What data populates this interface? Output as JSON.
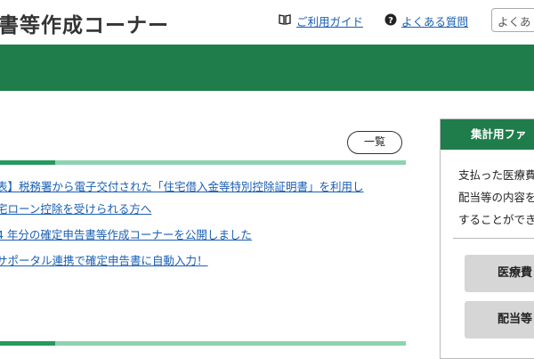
{
  "header": {
    "site_title": "書等作成コーナー",
    "guide_link": "ご利用ガイド",
    "faq_link": "よくある質問",
    "search_text": "よくあ",
    "guide_icon": "book-icon",
    "faq_icon": "question-circle-icon"
  },
  "news": {
    "list_button": "一覧",
    "items": [
      "表】税務署から電子交付された「住宅借入金等特別控除証明書」を利用し",
      "宅ローン控除を受けられる方へ",
      "4 年分の確定申告書等作成コーナーを公開しました",
      "サポータル連携で確定申告書に自動入力！"
    ]
  },
  "side": {
    "title": "集計用ファ",
    "lines": [
      "支払った医療費",
      "配当等の内容を",
      "することができ"
    ],
    "buttons": [
      "医療費",
      "配当等"
    ]
  },
  "colors": {
    "brand_green": "#1e7d4a",
    "rule_light": "#8ed3b1",
    "rule_dark": "#26995d",
    "link_blue": "#1a5fb4"
  }
}
